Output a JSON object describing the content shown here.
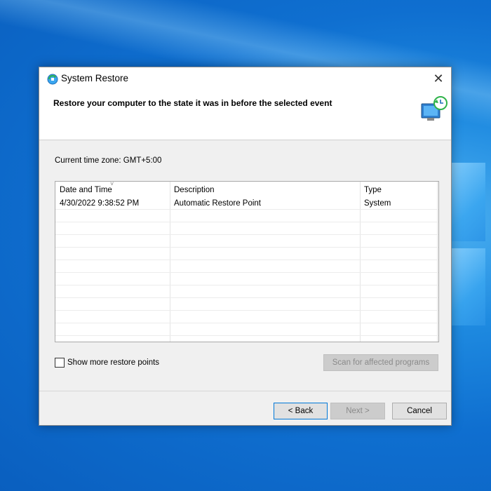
{
  "window": {
    "title": "System Restore",
    "close_glyph": "✕",
    "icon": "system-restore-icon"
  },
  "header": {
    "instruction": "Restore your computer to the state it was in before the selected event",
    "icon": "restore-computer-icon"
  },
  "timezone": {
    "label": "Current time zone: GMT+5:00"
  },
  "list": {
    "columns": [
      "Date and Time",
      "Description",
      "Type"
    ],
    "sort_glyph": "˅",
    "rows": [
      {
        "date_time": "4/30/2022 9:38:52 PM",
        "description": "Automatic Restore Point",
        "type": "System"
      }
    ]
  },
  "options": {
    "show_more_label": "Show more restore points",
    "show_more_checked": false
  },
  "buttons": {
    "scan": "Scan for affected programs",
    "back": "< Back",
    "next": "Next >",
    "cancel": "Cancel"
  },
  "colors": {
    "desktop": "#0f6fd0",
    "dialog_bg": "#f0f0f0",
    "focus_border": "#0078d7",
    "disabled_text": "#8a8a8a"
  }
}
